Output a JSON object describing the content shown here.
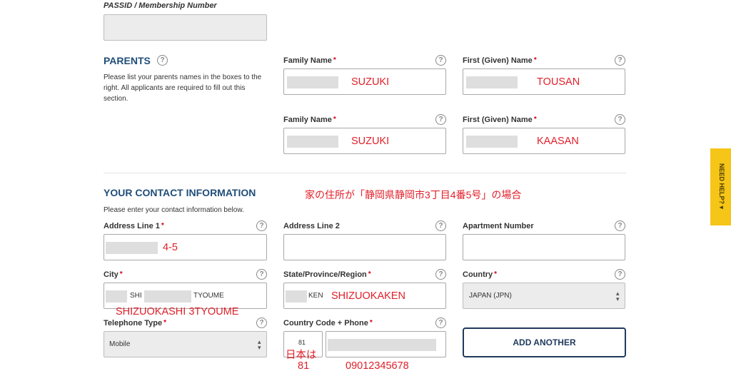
{
  "passid": {
    "label": "PASSID / Membership Number",
    "value": ""
  },
  "parents": {
    "title": "PARENTS",
    "description": "Please list your parents names in the boxes to the right. All applicants are required to fill out this section.",
    "family_name_label": "Family Name",
    "first_name_label": "First (Given) Name",
    "rows": [
      {
        "family_value": "SUZUKI",
        "first_value": "TOUSAN"
      },
      {
        "family_value": "SUZUKI",
        "first_value": "KAASAN"
      }
    ]
  },
  "contact": {
    "title": "YOUR CONTACT INFORMATION",
    "annotation": "家の住所が「静岡県静岡市3丁目4番5号」の場合",
    "description": "Please enter your contact information below.",
    "address1": {
      "label": "Address Line 1",
      "value": "4-5"
    },
    "address2": {
      "label": "Address Line 2",
      "value": ""
    },
    "apartment": {
      "label": "Apartment Number",
      "value": ""
    },
    "city": {
      "label": "City",
      "value_part1": "SHI",
      "value_part2": "TYOUME",
      "annotation": "SHIZUOKASHI 3TYOUME"
    },
    "state": {
      "label": "State/Province/Region",
      "value_part": "KEN",
      "annotation": "SHIZUOKAKEN"
    },
    "country": {
      "label": "Country",
      "value": "JAPAN (JPN)"
    },
    "telephone_type": {
      "label": "Telephone Type",
      "value": "Mobile"
    },
    "phone": {
      "label": "Country Code + Phone",
      "code_value": "81",
      "annotation_code_line1": "日本は",
      "annotation_code_line2": "81",
      "annotation_phone": "09012345678"
    },
    "add_another_label": "ADD ANOTHER"
  },
  "help_tab": {
    "label": "NEED HELP?",
    "arrow": "▾"
  },
  "colors": {
    "accent": "#1f4e79",
    "annotation_red": "#e0202a",
    "help_yellow": "#f5c518"
  }
}
